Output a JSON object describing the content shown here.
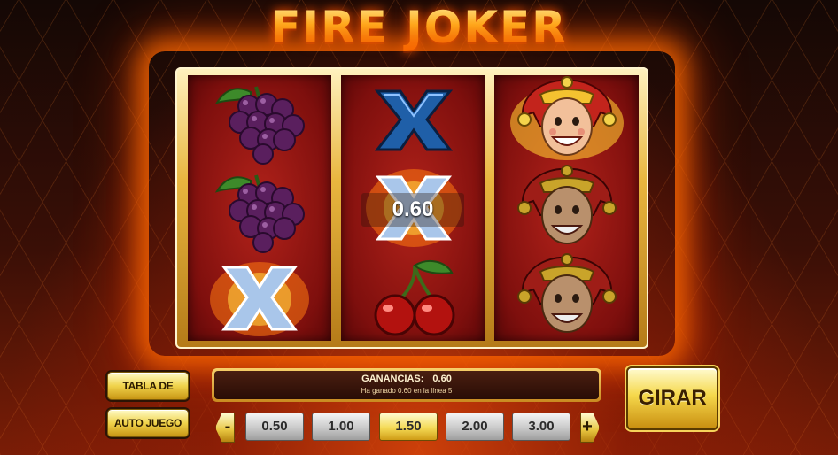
{
  "game": {
    "title": "FIRE JOKER"
  },
  "reels": [
    {
      "symbols": [
        "grapes-icon",
        "grapes-icon",
        "x-icon"
      ]
    },
    {
      "symbols": [
        "x-icon",
        "x-icon",
        "cherries-icon"
      ]
    },
    {
      "symbols": [
        "joker-icon",
        "joker-icon",
        "joker-icon"
      ]
    }
  ],
  "win_label": "0.60",
  "buttons": {
    "paytable": "TABLA DE PAGOS",
    "autoplay": "AUTO JUEGO",
    "spin": "GIRAR",
    "minus": "-",
    "plus": "+"
  },
  "winnings": {
    "label": "GANANCIAS:",
    "value": "0.60",
    "message": "Ha ganado 0.60 en la línea 5"
  },
  "bets": {
    "options": [
      "0.50",
      "1.00",
      "1.50",
      "2.00",
      "3.00"
    ],
    "selected": "1.50"
  },
  "colors": {
    "gold": "#f5d84b",
    "reel_red": "#8e1511",
    "flame": "#ff6a00"
  }
}
